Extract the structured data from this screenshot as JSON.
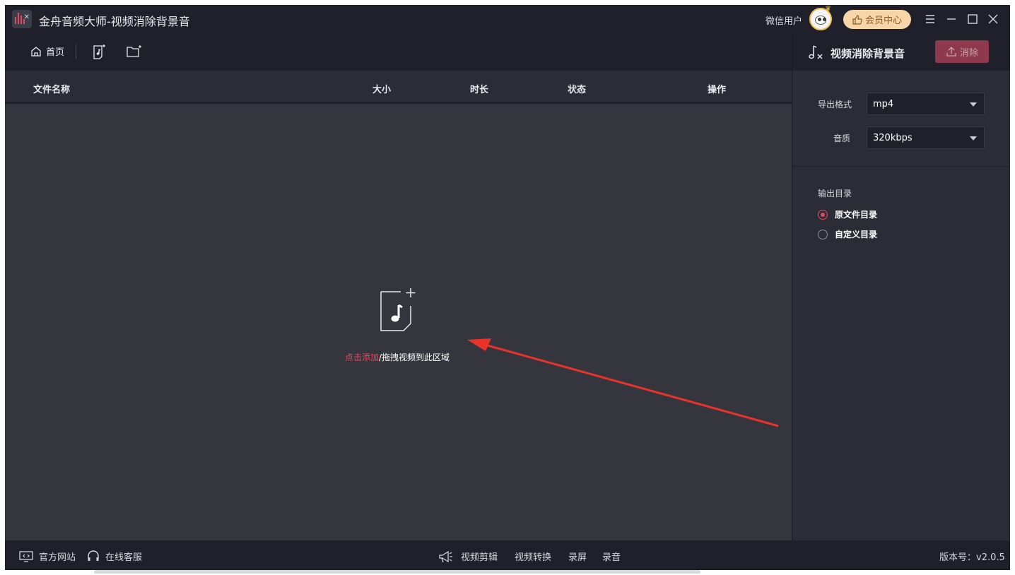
{
  "window": {
    "title": "金舟音频大师-视频消除背景音",
    "user_name": "微信用户",
    "vip_button": "会员中心",
    "controls": [
      "menu-icon",
      "minimize-icon",
      "maximize-icon",
      "close-icon"
    ]
  },
  "toolbar": {
    "home_label": "首页",
    "icons": [
      "add-audio-file-icon",
      "add-folder-icon"
    ]
  },
  "table": {
    "columns": [
      "文件名称",
      "大小",
      "时长",
      "状态",
      "操作"
    ],
    "rows": []
  },
  "drop_zone": {
    "link_text": "点击添加",
    "rest_text": "/拖拽视频到此区域"
  },
  "panel": {
    "title": "视频消除背景音",
    "remove_button": "消除",
    "format_label": "导出格式",
    "format_value": "mp4",
    "quality_label": "音质",
    "quality_value": "320kbps",
    "output_label": "输出目录",
    "output_options": [
      {
        "label": "原文件目录",
        "selected": true
      },
      {
        "label": "自定义目录",
        "selected": false
      }
    ]
  },
  "footer": {
    "website": "官方网站",
    "service": "在线客服",
    "tools": [
      "视频剪辑",
      "视频转换",
      "录屏",
      "录音"
    ],
    "version": "版本号：v2.0.5"
  },
  "colors": {
    "accent": "#e24a62",
    "background": "#34353d",
    "panel": "#2b2c35",
    "bar": "#1f2029"
  }
}
